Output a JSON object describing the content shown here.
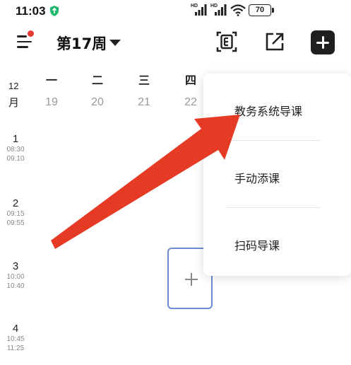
{
  "status_bar": {
    "time": "11:03",
    "hd1": "HD",
    "hd2": "HD",
    "battery": "70"
  },
  "header": {
    "week_title": "第17周"
  },
  "calendar": {
    "month_number": "12",
    "month_unit": "月",
    "days": [
      {
        "name": "一",
        "date": "19"
      },
      {
        "name": "二",
        "date": "20"
      },
      {
        "name": "三",
        "date": "21"
      },
      {
        "name": "四",
        "date": "22"
      }
    ],
    "periods": [
      {
        "num": "1",
        "start": "08:30",
        "end": "09:10"
      },
      {
        "num": "2",
        "start": "09:15",
        "end": "09:55"
      },
      {
        "num": "3",
        "start": "10:00",
        "end": "10:40"
      },
      {
        "num": "4",
        "start": "10:45",
        "end": "11:25"
      }
    ]
  },
  "popup_menu": {
    "items": [
      {
        "label": "教务系统导课"
      },
      {
        "label": "手动添课"
      },
      {
        "label": "扫码导课"
      }
    ]
  },
  "colors": {
    "arrow": "#e53a23",
    "add_slot_border": "#6a8bd0",
    "notification_dot": "#e53935",
    "add_button_bg": "#1e1e1e"
  }
}
